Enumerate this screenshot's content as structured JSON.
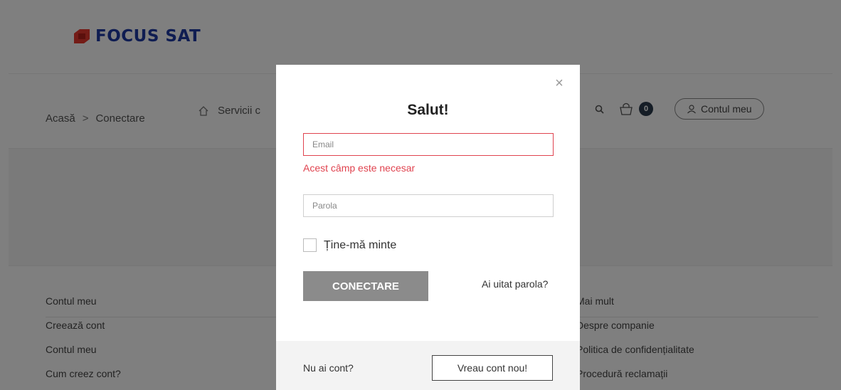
{
  "brand": {
    "name": "FOCUS SAT",
    "primary_color": "#1f3aa5",
    "logo_color": "#e8392f"
  },
  "breadcrumb": {
    "home": "Acasă",
    "separator": ">",
    "current": "Conectare"
  },
  "nav": {
    "services_label": "Servicii c",
    "cart_count": "0",
    "account_label": "Contul meu"
  },
  "footer": {
    "left_heading": "Contul meu",
    "left_items": [
      "Creează cont",
      "Contul meu",
      "Cum creez cont?"
    ],
    "right_heading": "Mai mult",
    "right_items": [
      "Despre companie",
      "Politica de confidențialitate",
      "Procedură reclamații"
    ]
  },
  "modal": {
    "title": "Salut!",
    "email_placeholder": "Email",
    "email_error": "Acest câmp este necesar",
    "password_placeholder": "Parola",
    "remember_label": "Ține-mă minte",
    "submit_label": "CONECTARE",
    "forgot_label": "Ai uitat parola?",
    "no_account_label": "Nu ai cont?",
    "register_label": "Vreau cont nou!",
    "close_label": "×",
    "error_color": "#e0434f"
  }
}
